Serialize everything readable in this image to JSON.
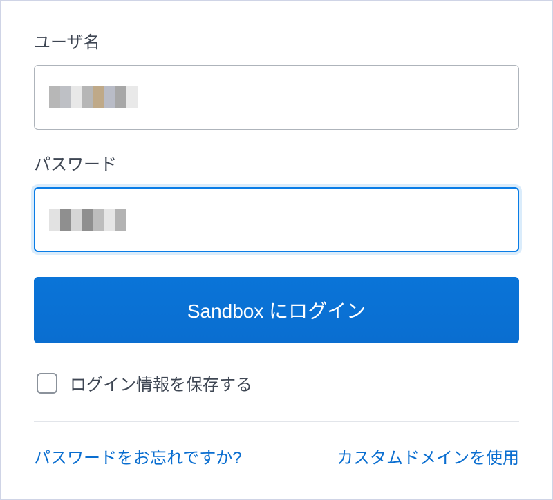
{
  "form": {
    "username_label": "ユーザ名",
    "username_value": "",
    "password_label": "パスワード",
    "password_value": "",
    "login_button_label": "Sandbox にログイン",
    "remember_label": "ログイン情報を保存する",
    "remember_checked": false
  },
  "links": {
    "forgot_password": "パスワードをお忘れですか?",
    "custom_domain": "カスタムドメインを使用"
  },
  "colors": {
    "primary": "#0a6ed0",
    "focus": "#0a7de6",
    "text": "#3e4653",
    "border": "#aeb4bb",
    "divider": "#e2e5ea"
  },
  "redaction": {
    "username_blocks": [
      "#b7b7b7",
      "#bec0c5",
      "#e8e8e8",
      "#b6b6b6",
      "#bfa988",
      "#b9bcc7",
      "#a7a7a7",
      "#e9e9e9"
    ],
    "password_blocks": [
      "#e2e2e2",
      "#8f8f8f",
      "#d6d6d6",
      "#8f8f8f",
      "#bdbdbd",
      "#e6e6e6",
      "#b3b3b3"
    ]
  }
}
